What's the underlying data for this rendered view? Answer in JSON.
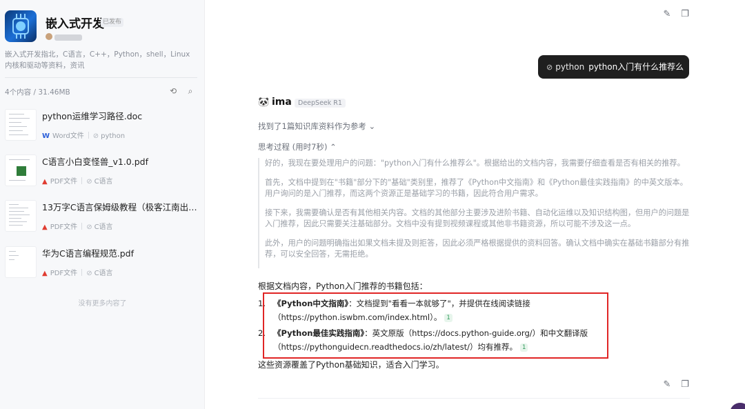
{
  "sidebar": {
    "title": "嵌入式开发",
    "badge": "已发布",
    "description": "嵌入式开发指北，C语言，C++，Python，shell，Linux 内核和驱动等资料，资讯",
    "stats": "4个内容 / 31.46MB",
    "files": [
      {
        "name": "python运维学习路径.doc",
        "type_label": "Word文件",
        "type_icon": "W",
        "tag": "python"
      },
      {
        "name": "C语言小白变怪兽_v1.0.pdf",
        "type_label": "PDF文件",
        "type_icon": "▲",
        "tag": "C语言"
      },
      {
        "name": "13万字C语言保姆级教程（极客江南出品...",
        "type_label": "PDF文件",
        "type_icon": "▲",
        "tag": "C语言"
      },
      {
        "name": "华为C语言编程规范.pdf",
        "type_label": "PDF文件",
        "type_icon": "▲",
        "tag": "C语言"
      }
    ],
    "no_more": "没有更多内容了"
  },
  "chat": {
    "user_message": {
      "ref": "python",
      "text": "python入门有什么推荐么"
    },
    "bot": {
      "name": "ima",
      "model": "DeepSeek R1",
      "refs": "找到了1篇知识库资料作为参考 ⌄",
      "thinking_label": "思考过程 (用时7秒) ⌃",
      "thinking": [
        "好的，我现在要处理用户的问题：\"python入门有什么推荐么\"。根据给出的文档内容，我需要仔细查看是否有相关的推荐。",
        "首先，文档中提到在\"书籍\"部分下的\"基础\"类别里，推荐了《Python中文指南》和《Python最佳实践指南》的中英文版本。用户询问的是入门推荐，而这两个资源正是基础学习的书籍，因此符合用户需求。",
        "接下来，我需要确认是否有其他相关内容。文档的其他部分主要涉及进阶书籍、自动化运维以及知识结构图，但用户的问题是入门推荐，因此只需要关注基础部分。文档中没有提到视频课程或其他非书籍资源，所以可能不涉及这一点。",
        "此外，用户的问题明确指出如果文档未提及则拒答，因此必须严格根据提供的资料回答。确认文档中确实在基础书籍部分有推荐，可以安全回答，无需拒绝。"
      ],
      "answer_intro": "根据文档内容，Python入门推荐的书籍包括：",
      "items": [
        {
          "num": "1.",
          "title": "《Python中文指南》",
          "body": "：文档提到\"看看一本就够了\"，并提供在线阅读链接（https://python.iswbm.com/index.html）。",
          "cite": "1"
        },
        {
          "num": "2.",
          "title": "《Python最佳实践指南》",
          "body": "：英文原版（https://docs.python-guide.org/）和中文翻译版（https://pythonguidecn.readthedocs.io/zh/latest/）均有推荐。",
          "cite": "1"
        }
      ],
      "answer_outro": "这些资源覆盖了Python基础知识，适合入门学习。"
    }
  },
  "icons": {
    "edit": "edit-icon",
    "copy": "copy-icon",
    "refresh": "refresh-icon",
    "search": "search-icon"
  },
  "colors": {
    "highlight_border": "#e02424",
    "user_bubble": "#1f1f1f",
    "pdf": "#e03c31",
    "word": "#2b5fd9",
    "cite": "#2f9a5a"
  }
}
